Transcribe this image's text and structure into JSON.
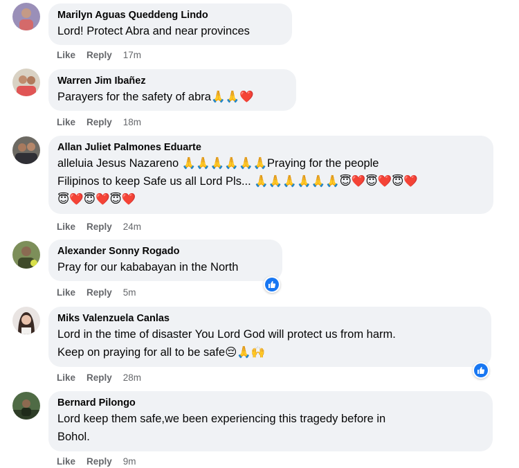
{
  "colors": {
    "bubble_bg": "#f0f2f5",
    "action_text": "#65676b",
    "like_badge": "#1877f2"
  },
  "comments": [
    {
      "author": "Marilyn Aguas Queddeng Lindo",
      "lines": [
        "Lord! Protect Abra and near provinces"
      ],
      "like": "Like",
      "reply": "Reply",
      "time": "17m"
    },
    {
      "author": "Warren Jim Ibañez",
      "lines": [
        "Parayers for the safety of abra🙏🙏❤️"
      ],
      "like": "Like",
      "reply": "Reply",
      "time": "18m"
    },
    {
      "author": "Allan Juliet Palmones Eduarte",
      "lines": [
        "alleluia Jesus Nazareno 🙏🙏🙏🙏🙏🙏Praying for the people",
        "Filipinos to keep Safe us all Lord Pls... 🙏🙏🙏🙏🙏🙏😇❤️😇❤️😇❤️",
        "😇❤️😇❤️😇❤️"
      ],
      "like": "Like",
      "reply": "Reply",
      "time": "24m"
    },
    {
      "author": "Alexander Sonny Rogado",
      "lines": [
        "Pray for our kababayan in the North"
      ],
      "like": "Like",
      "reply": "Reply",
      "time": "5m",
      "reaction": "like-icon"
    },
    {
      "author": "Miks Valenzuela Canlas",
      "lines": [
        "Lord in the time of disaster You Lord God will protect us from harm.",
        "Keep on praying for all to be safe😔🙏🙌"
      ],
      "like": "Like",
      "reply": "Reply",
      "time": "28m",
      "reaction": "like-icon"
    },
    {
      "author": "Bernard Pilongo",
      "lines": [
        "Lord keep them safe,we been experiencing this tragedy before in",
        "Bohol."
      ],
      "like": "Like",
      "reply": "Reply",
      "time": "9m"
    }
  ]
}
